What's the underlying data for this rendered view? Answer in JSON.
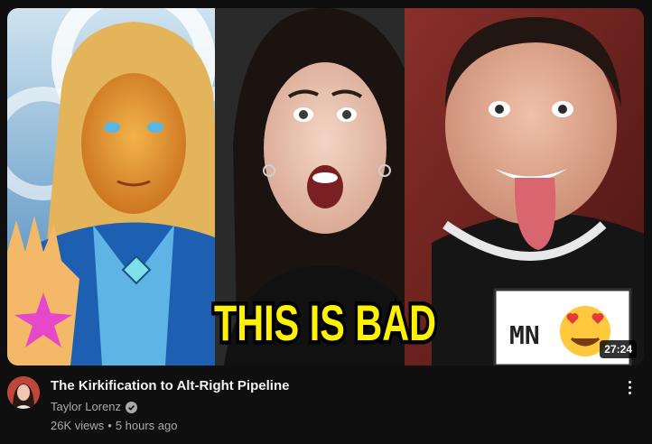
{
  "video": {
    "thumbnail_caption": "THIS IS BAD",
    "thumbnail_sticker_text": "MN",
    "duration": "27:24",
    "title": "The Kirkification to Alt-Right Pipeline",
    "channel": "Taylor Lorenz",
    "views": "26K views",
    "separator": "•",
    "age": "5 hours ago"
  },
  "icons": {
    "verified": "verified-check-icon",
    "menu": "more-vertical-icon"
  },
  "colors": {
    "background": "#0f0f0f",
    "caption_fill": "#fff200",
    "secondary_text": "#aaaaaa"
  }
}
